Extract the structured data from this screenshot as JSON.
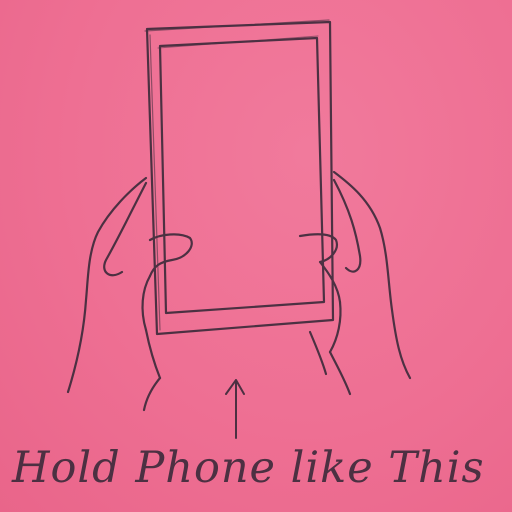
{
  "caption": "Hold Phone like This",
  "colors": {
    "paper": "#ee6f93",
    "pencil": "#3b2a3a"
  },
  "icons": {
    "pointer": "up-arrow-icon"
  }
}
